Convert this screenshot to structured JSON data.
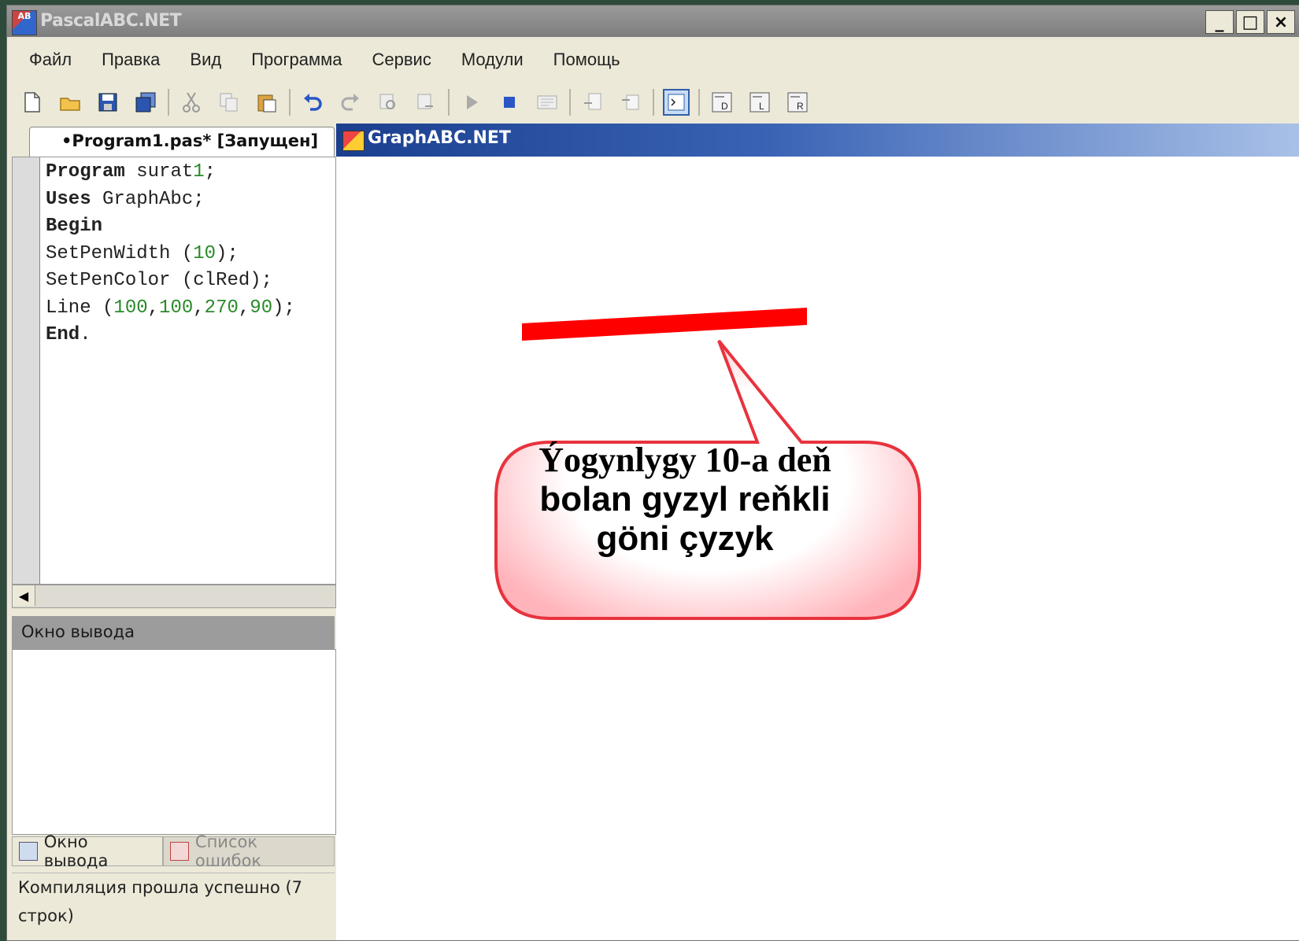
{
  "window": {
    "title": "PascalABC.NET",
    "buttons": {
      "minimize": "_",
      "maximize": "□",
      "close": "×"
    }
  },
  "menu": {
    "items": [
      "Файл",
      "Правка",
      "Вид",
      "Программа",
      "Сервис",
      "Модули",
      "Помощь"
    ]
  },
  "toolbar": {
    "icons": [
      "new-file-icon",
      "open-folder-icon",
      "save-icon",
      "save-all-icon",
      "sep",
      "cut-icon",
      "copy-icon",
      "paste-icon",
      "sep",
      "undo-icon",
      "redo-icon",
      "find-icon",
      "replace-icon",
      "sep",
      "run-icon",
      "stop-icon",
      "compile-icon",
      "sep",
      "step-into-icon",
      "step-over-icon",
      "sep",
      "console-icon",
      "sep",
      "debug-d-icon",
      "debug-l-icon",
      "debug-r-icon"
    ]
  },
  "editor": {
    "tab_label": "•Program1.pas* [Запущен]",
    "code_lines": [
      "Program surat1;",
      "Uses GraphAbc;",
      "Begin",
      "SetPenWidth (10);",
      "SetPenColor (clRed);",
      "Line (100,100,270,90);",
      "End."
    ]
  },
  "output": {
    "header": "Окно вывода",
    "tabs": [
      "Окно вывода",
      "Список ошибок"
    ],
    "status": "Компиляция прошла успешно (7 строк)"
  },
  "graph_window": {
    "title": "GraphABC.NET",
    "line_color": "#ff0000",
    "callout_lines": [
      "Ýogynlygy  10-a deň",
      "bolan gyzyl reňkli",
      "göni çyzyk"
    ],
    "callout_border_color": "#e8333e"
  }
}
